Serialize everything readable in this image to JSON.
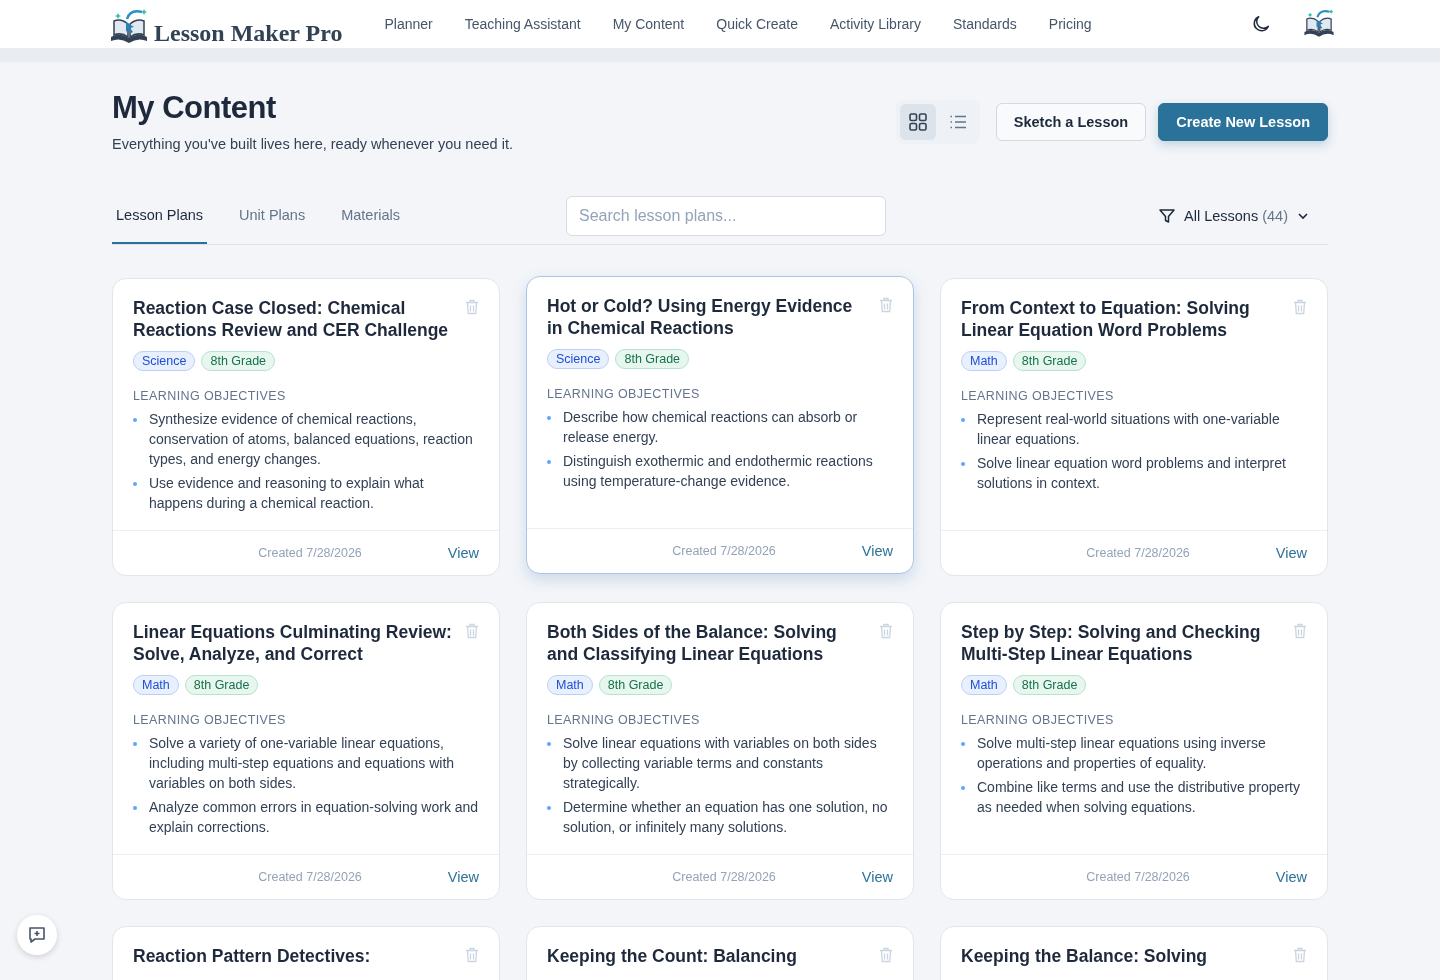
{
  "brand": {
    "name": "Lesson Maker Pro"
  },
  "nav": [
    "Planner",
    "Teaching Assistant",
    "My Content",
    "Quick Create",
    "Activity Library",
    "Standards",
    "Pricing"
  ],
  "header": {
    "title": "My Content",
    "subtitle": "Everything you've built lives here, ready whenever you need it."
  },
  "view_toggle": [
    {
      "kind": "grid",
      "selected": true
    },
    {
      "kind": "list",
      "selected": false
    }
  ],
  "actions": [
    {
      "label": "Sketch a Lesson",
      "kind": "secondary"
    },
    {
      "label": "Create New Lesson",
      "kind": "primary"
    }
  ],
  "tabs": [
    {
      "label": "Lesson Plans",
      "selected": true
    },
    {
      "label": "Unit Plans",
      "selected": false
    },
    {
      "label": "Materials",
      "selected": false
    }
  ],
  "search": {
    "placeholder": "Search lesson plans..."
  },
  "filter": {
    "label": "All Lessons",
    "count": "(44)"
  },
  "cards": [
    {
      "title": "Reaction Case Closed: Chemical Reactions Review and CER Challenge",
      "highlighted": false,
      "tags": [
        {
          "label": "Science",
          "kind": "subject"
        },
        {
          "label": "8th Grade",
          "kind": "grade"
        }
      ],
      "objectives_heading": "LEARNING OBJECTIVES",
      "objectives": [
        "Synthesize evidence of chemical reactions, conservation of atoms, balanced equations, reaction types, and energy changes.",
        "Use evidence and reasoning to explain what happens during a chemical reaction."
      ],
      "created": "Created 7/28/2026",
      "link": "View"
    },
    {
      "title": "Hot or Cold? Using Energy Evidence in Chemical Reactions",
      "highlighted": true,
      "tags": [
        {
          "label": "Science",
          "kind": "subject"
        },
        {
          "label": "8th Grade",
          "kind": "grade"
        }
      ],
      "objectives_heading": "LEARNING OBJECTIVES",
      "objectives": [
        "Describe how chemical reactions can absorb or release energy.",
        "Distinguish exothermic and endothermic reactions using temperature-change evidence."
      ],
      "created": "Created 7/28/2026",
      "link": "View"
    },
    {
      "title": "From Context to Equation: Solving Linear Equation Word Problems",
      "highlighted": false,
      "tags": [
        {
          "label": "Math",
          "kind": "subject"
        },
        {
          "label": "8th Grade",
          "kind": "grade"
        }
      ],
      "objectives_heading": "LEARNING OBJECTIVES",
      "objectives": [
        "Represent real-world situations with one-variable linear equations.",
        "Solve linear equation word problems and interpret solutions in context."
      ],
      "created": "Created 7/28/2026",
      "link": "View"
    },
    {
      "title": "Linear Equations Culminating Review: Solve, Analyze, and Correct",
      "highlighted": false,
      "tags": [
        {
          "label": "Math",
          "kind": "subject"
        },
        {
          "label": "8th Grade",
          "kind": "grade"
        }
      ],
      "objectives_heading": "LEARNING OBJECTIVES",
      "objectives": [
        "Solve a variety of one-variable linear equations, including multi-step equations and equations with variables on both sides.",
        "Analyze common errors in equation-solving work and explain corrections."
      ],
      "created": "Created 7/28/2026",
      "link": "View"
    },
    {
      "title": "Both Sides of the Balance: Solving and Classifying Linear Equations",
      "highlighted": false,
      "tags": [
        {
          "label": "Math",
          "kind": "subject"
        },
        {
          "label": "8th Grade",
          "kind": "grade"
        }
      ],
      "objectives_heading": "LEARNING OBJECTIVES",
      "objectives": [
        "Solve linear equations with variables on both sides by collecting variable terms and constants strategically.",
        "Determine whether an equation has one solution, no solution, or infinitely many solutions."
      ],
      "created": "Created 7/28/2026",
      "link": "View"
    },
    {
      "title": "Step by Step: Solving and Checking Multi-Step Linear Equations",
      "highlighted": false,
      "tags": [
        {
          "label": "Math",
          "kind": "subject"
        },
        {
          "label": "8th Grade",
          "kind": "grade"
        }
      ],
      "objectives_heading": "LEARNING OBJECTIVES",
      "objectives": [
        "Solve multi-step linear equations using inverse operations and properties of equality.",
        "Combine like terms and use the distributive property as needed when solving equations."
      ],
      "created": "Created 7/28/2026",
      "link": "View"
    },
    {
      "title": "Reaction Pattern Detectives:",
      "highlighted": false
    },
    {
      "title": "Keeping the Count: Balancing",
      "highlighted": false
    },
    {
      "title": "Keeping the Balance: Solving",
      "highlighted": false
    }
  ]
}
